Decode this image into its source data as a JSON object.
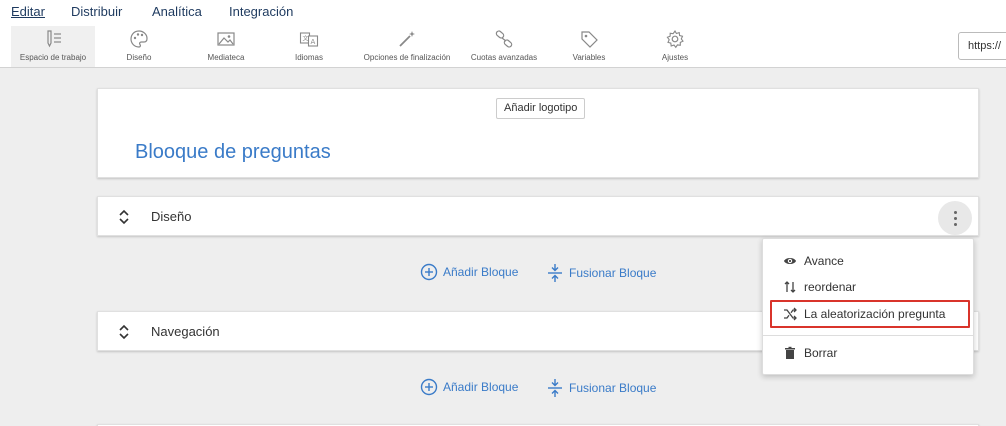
{
  "topmenu": {
    "items": [
      {
        "label": "Editar",
        "active": true
      },
      {
        "label": "Distribuir"
      },
      {
        "label": "Analítica"
      },
      {
        "label": "Integración"
      }
    ]
  },
  "toolbar": {
    "items": [
      {
        "label": "Espacio de trabajo",
        "icon": "pencil-icon",
        "active": true
      },
      {
        "label": "Diseño",
        "icon": "palette-icon"
      },
      {
        "label": "Mediateca",
        "icon": "image-icon"
      },
      {
        "label": "Idiomas",
        "icon": "translate-icon"
      },
      {
        "label": "Opciones de finalización",
        "icon": "magic-wand-icon"
      },
      {
        "label": "Cuotas avanzadas",
        "icon": "link-icon"
      },
      {
        "label": "Variables",
        "icon": "tag-icon"
      },
      {
        "label": "Ajustes",
        "icon": "gear-icon"
      }
    ],
    "url_value": "https://"
  },
  "header": {
    "logo_button": "Añadir logotipo",
    "title": "Blooque de preguntas"
  },
  "blocks": [
    {
      "label": "Diseño"
    },
    {
      "label": "Navegación"
    }
  ],
  "actions": {
    "add_block": "Añadir Bloque",
    "merge_block": "Fusionar Bloque"
  },
  "dropdown": {
    "items": [
      {
        "label": "Avance",
        "icon": "eye-icon"
      },
      {
        "label": "reordenar",
        "icon": "reorder-icon"
      },
      {
        "label": "La aleatorización pregunta",
        "icon": "shuffle-icon",
        "highlighted": true
      },
      {
        "label": "Borrar",
        "icon": "trash-icon"
      }
    ]
  },
  "colors": {
    "accent": "#3a7bc8",
    "nav_text": "#1e3a5f",
    "highlight": "#d9342b",
    "background": "#eeeeee"
  }
}
